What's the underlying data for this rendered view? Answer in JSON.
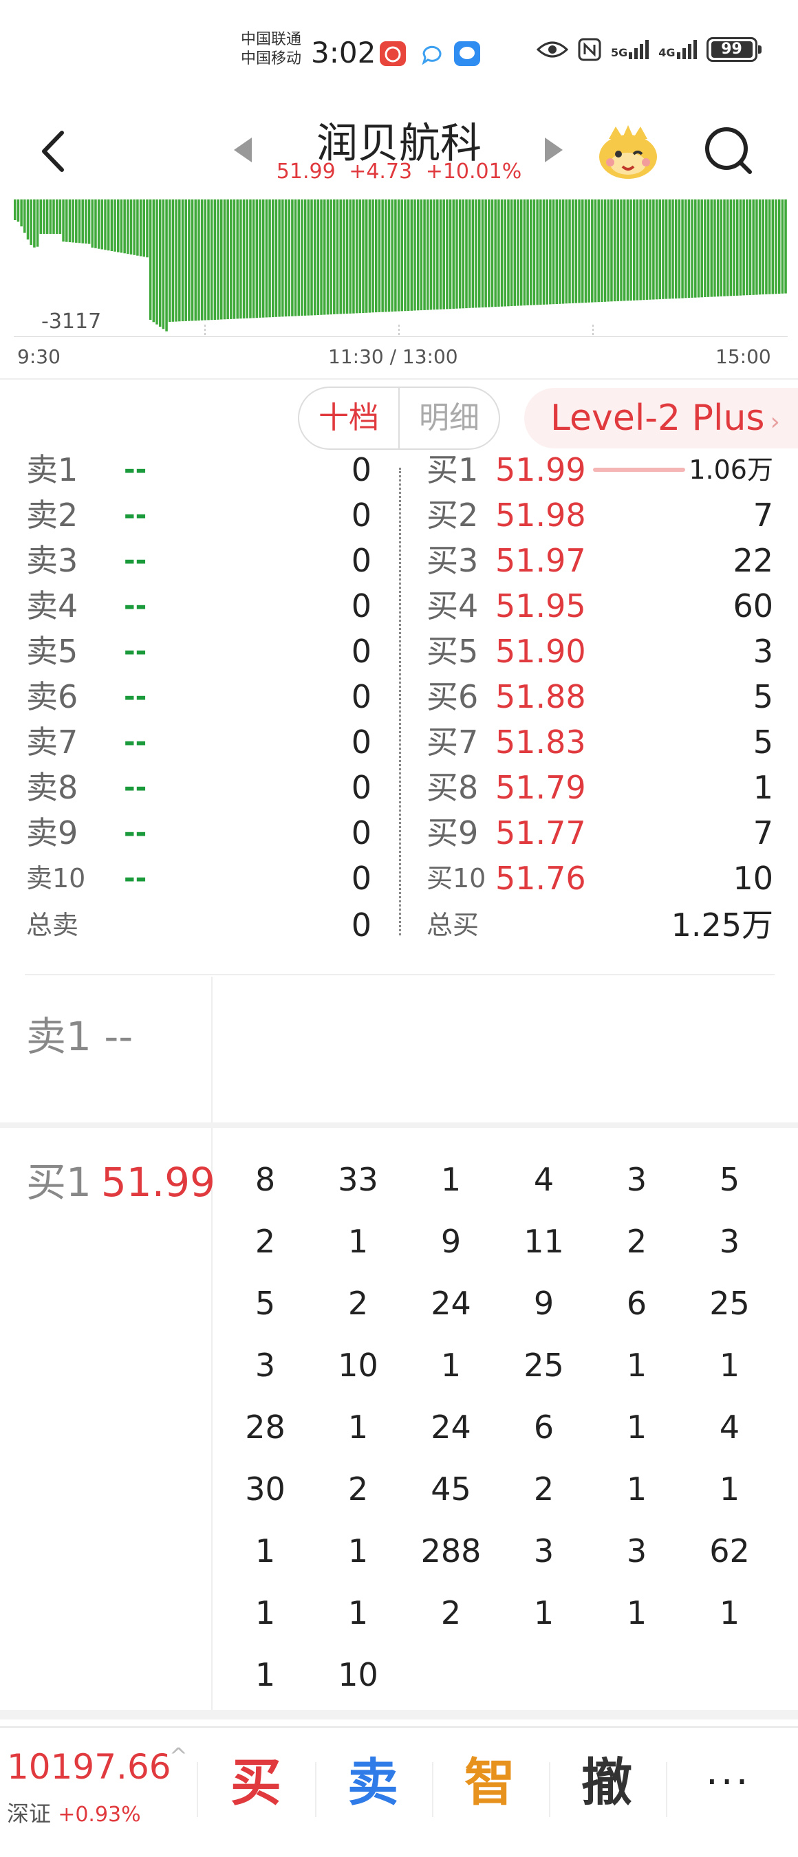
{
  "status_bar": {
    "carrier1": "中国联通",
    "carrier2": "中国移动",
    "time": "3:02",
    "net1": "5G",
    "net2": "4G",
    "battery": "99"
  },
  "header": {
    "title": "润贝航科",
    "price": "51.99",
    "change": "+4.73",
    "change_pct": "+10.01%"
  },
  "chart": {
    "min_label": "-3117",
    "time_start": "9:30",
    "time_mid": "11:30 / 13:00",
    "time_end": "15:00",
    "bar_color": "#3fa93a"
  },
  "tabs": {
    "tab1": "十档",
    "tab2": "明细",
    "level2": "Level-2 Plus"
  },
  "order_book": {
    "sells": [
      {
        "label": "卖1",
        "price": "--",
        "vol": "0"
      },
      {
        "label": "卖2",
        "price": "--",
        "vol": "0"
      },
      {
        "label": "卖3",
        "price": "--",
        "vol": "0"
      },
      {
        "label": "卖4",
        "price": "--",
        "vol": "0"
      },
      {
        "label": "卖5",
        "price": "--",
        "vol": "0"
      },
      {
        "label": "卖6",
        "price": "--",
        "vol": "0"
      },
      {
        "label": "卖7",
        "price": "--",
        "vol": "0"
      },
      {
        "label": "卖8",
        "price": "--",
        "vol": "0"
      },
      {
        "label": "卖9",
        "price": "--",
        "vol": "0"
      },
      {
        "label": "卖10",
        "price": "--",
        "vol": "0"
      }
    ],
    "buys": [
      {
        "label": "买1",
        "price": "51.99",
        "vol": "1.06万"
      },
      {
        "label": "买2",
        "price": "51.98",
        "vol": "7"
      },
      {
        "label": "买3",
        "price": "51.97",
        "vol": "22"
      },
      {
        "label": "买4",
        "price": "51.95",
        "vol": "60"
      },
      {
        "label": "买5",
        "price": "51.90",
        "vol": "3"
      },
      {
        "label": "买6",
        "price": "51.88",
        "vol": "5"
      },
      {
        "label": "买7",
        "price": "51.83",
        "vol": "5"
      },
      {
        "label": "买8",
        "price": "51.79",
        "vol": "1"
      },
      {
        "label": "买9",
        "price": "51.77",
        "vol": "7"
      },
      {
        "label": "买10",
        "price": "51.76",
        "vol": "10"
      }
    ],
    "total_sell_label": "总卖",
    "total_sell": "0",
    "total_buy_label": "总买",
    "total_buy": "1.25万"
  },
  "queue": {
    "sell1_label": "卖1 --",
    "buy1_label": "买1",
    "buy1_price": "51.99",
    "orders": [
      "8",
      "33",
      "1",
      "4",
      "3",
      "5",
      "2",
      "1",
      "9",
      "11",
      "2",
      "3",
      "5",
      "2",
      "24",
      "9",
      "6",
      "25",
      "3",
      "10",
      "1",
      "25",
      "1",
      "1",
      "28",
      "1",
      "24",
      "6",
      "1",
      "4",
      "30",
      "2",
      "45",
      "2",
      "1",
      "1",
      "1",
      "1",
      "288",
      "3",
      "3",
      "62",
      "1",
      "1",
      "2",
      "1",
      "1",
      "1",
      "1",
      "10"
    ]
  },
  "bottom_bar": {
    "index_value": "10197.66",
    "index_name": "深证",
    "index_change": "+0.93%",
    "buy": "买",
    "sell": "卖",
    "smart": "智",
    "cancel": "撤",
    "more": "···"
  }
}
